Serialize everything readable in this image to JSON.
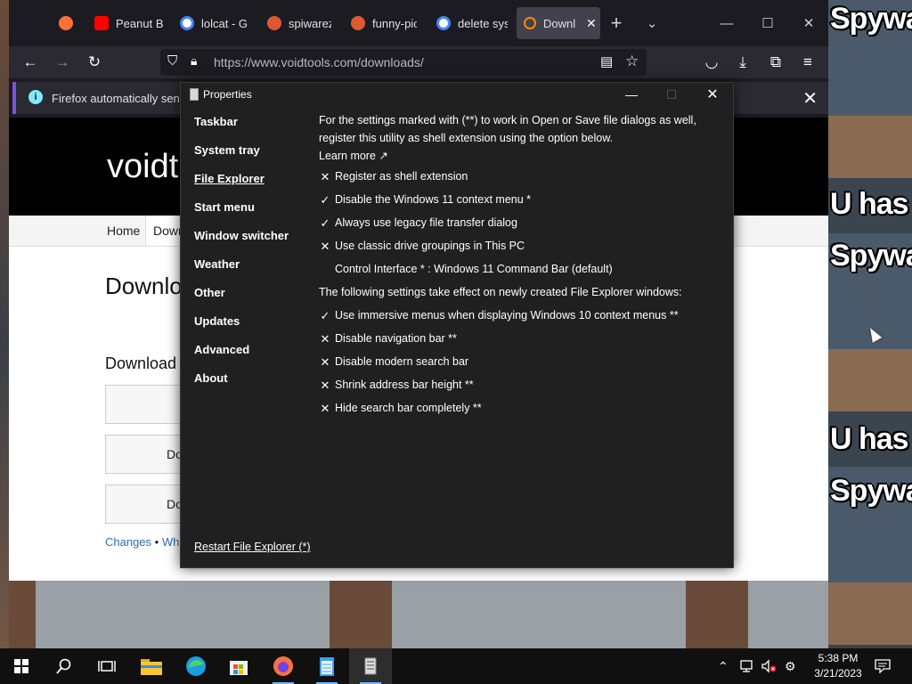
{
  "wallpaper": {
    "meme_lines": [
      "Spywa",
      "U has",
      "Spywa",
      "U has",
      "Spywa"
    ]
  },
  "browser": {
    "tabs": [
      {
        "label": "",
        "icon": "firefox-icon",
        "color": "#ff7139"
      },
      {
        "label": "Peanut B",
        "icon": "youtube-icon",
        "color": "#ff0000"
      },
      {
        "label": "lolcat - Go",
        "icon": "google-icon",
        "color": "#4285f4"
      },
      {
        "label": "spiwarez",
        "icon": "duckduckgo-icon",
        "color": "#de5833"
      },
      {
        "label": "funny-pic",
        "icon": "duckduckgo-icon",
        "color": "#de5833"
      },
      {
        "label": "delete sys",
        "icon": "google-icon",
        "color": "#4285f4"
      },
      {
        "label": "Downl",
        "icon": "search-icon",
        "color": "#ff8a00"
      }
    ],
    "url": "https://www.voidtools.com/downloads/",
    "notification": "Firefox automatically sends"
  },
  "webpage": {
    "logo_text": "voidt",
    "menu": [
      "Home",
      "Down"
    ],
    "heading": "Downlo",
    "subheading": "Download",
    "buttons": [
      "",
      "Do",
      "Do"
    ],
    "links": [
      "Changes",
      "•",
      "Wh"
    ]
  },
  "dialog": {
    "title": "Properties",
    "sidebar": [
      "Taskbar",
      "System tray",
      "File Explorer",
      "Start menu",
      "Window switcher",
      "Weather",
      "Other",
      "Updates",
      "Advanced",
      "About"
    ],
    "active_item": "File Explorer",
    "intro_1": "For the settings marked with (**) to work in Open or Save file dialogs as well, register this utility as shell extension using the option below.",
    "learn_more": "Learn more ↗",
    "settings": [
      {
        "mark": "✕",
        "text": "Register as shell extension"
      },
      {
        "mark": "✓",
        "text": "Disable the Windows 11 context menu *"
      },
      {
        "mark": "✓",
        "text": "Always use legacy file transfer dialog"
      },
      {
        "mark": "✕",
        "text": "Use classic drive groupings in This PC"
      },
      {
        "mark": "",
        "text": "Control Interface * : Windows 11 Command Bar (default)"
      }
    ],
    "note": "The following settings take effect on newly created File Explorer windows:",
    "settings_2": [
      {
        "mark": "✓",
        "text": "Use immersive menus when displaying Windows 10 context menus **"
      },
      {
        "mark": "✕",
        "text": "Disable navigation bar **"
      },
      {
        "mark": "✕",
        "text": "Disable modern search bar"
      },
      {
        "mark": "✕",
        "text": "Shrink address bar height **"
      },
      {
        "mark": "✕",
        "text": "Hide search bar completely **"
      }
    ],
    "restart": "Restart File Explorer (*)"
  },
  "taskbar": {
    "time": "5:38 PM",
    "date": "3/21/2023",
    "apps": [
      "start-icon",
      "search-icon",
      "task-view-icon",
      "file-explorer-icon",
      "edge-icon",
      "store-icon",
      "firefox-icon",
      "notepad-icon",
      "properties-app-icon"
    ]
  }
}
